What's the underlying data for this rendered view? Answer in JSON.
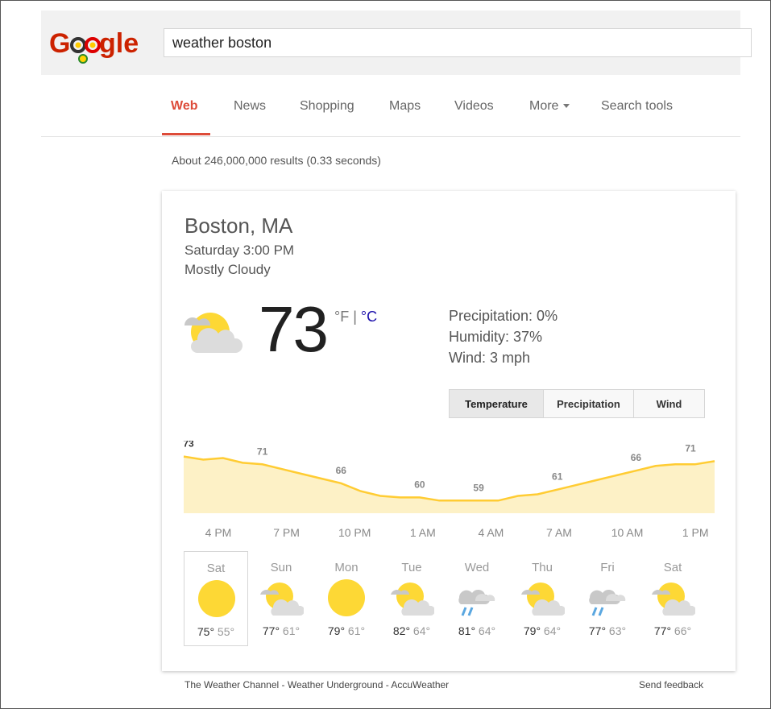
{
  "search": {
    "query": "weather boston"
  },
  "logo": {
    "text": "Google"
  },
  "tabs": [
    {
      "label": "Web",
      "active": true
    },
    {
      "label": "News"
    },
    {
      "label": "Shopping"
    },
    {
      "label": "Maps"
    },
    {
      "label": "Videos"
    },
    {
      "label": "More"
    },
    {
      "label": "Search tools"
    }
  ],
  "result_stats": "About 246,000,000 results (0.33 seconds)",
  "weather": {
    "location": "Boston, MA",
    "datetime": "Saturday 3:00 PM",
    "condition": "Mostly Cloudy",
    "current_icon": "partly-cloudy-icon",
    "temperature": "73",
    "unit_f": "°F",
    "unit_sep": " | ",
    "unit_c": "°C",
    "precipitation": "Precipitation: 0%",
    "humidity": "Humidity: 37%",
    "wind": "Wind: 3 mph",
    "toggle": [
      "Temperature",
      "Precipitation",
      "Wind"
    ],
    "toggle_active": "Temperature",
    "accent_color": "#ffcc33",
    "hourly": {
      "times": [
        "4 PM",
        "7 PM",
        "10 PM",
        "1 AM",
        "4 AM",
        "7 AM",
        "10 AM",
        "1 PM"
      ],
      "labels": [
        73,
        71,
        66,
        60,
        59,
        61,
        66,
        71
      ],
      "temps": [
        73,
        72,
        72.5,
        71,
        70.5,
        69,
        67.5,
        66,
        64.5,
        62,
        60.5,
        60,
        60,
        59,
        59,
        59,
        59,
        60.5,
        61,
        62.5,
        64,
        65.5,
        67,
        68.5,
        70,
        70.5,
        70.5,
        71.5
      ],
      "ylim": [
        55,
        78
      ]
    },
    "days": [
      {
        "name": "Sat",
        "icon": "sun-icon",
        "hi": "75°",
        "lo": "55°",
        "selected": true
      },
      {
        "name": "Sun",
        "icon": "partly-cloudy-icon",
        "hi": "77°",
        "lo": "61°"
      },
      {
        "name": "Mon",
        "icon": "sun-icon",
        "hi": "79°",
        "lo": "61°"
      },
      {
        "name": "Tue",
        "icon": "partly-cloudy-icon",
        "hi": "82°",
        "lo": "64°"
      },
      {
        "name": "Wed",
        "icon": "rain-icon",
        "hi": "81°",
        "lo": "64°"
      },
      {
        "name": "Thu",
        "icon": "partly-cloudy-icon",
        "hi": "79°",
        "lo": "64°"
      },
      {
        "name": "Fri",
        "icon": "rain-icon",
        "hi": "77°",
        "lo": "63°"
      },
      {
        "name": "Sat",
        "icon": "partly-cloudy-icon",
        "hi": "77°",
        "lo": "66°"
      }
    ],
    "sources": "The Weather Channel - Weather Underground - AccuWeather",
    "feedback": "Send feedback"
  }
}
